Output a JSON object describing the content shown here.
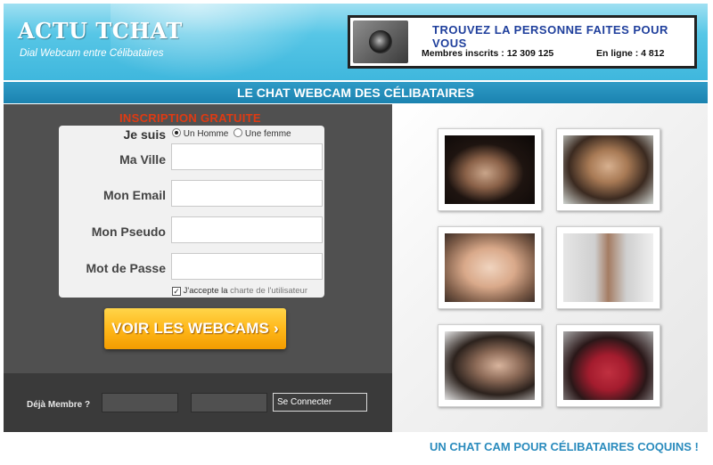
{
  "header": {
    "site_title": "ACTU TCHAT",
    "site_subtitle": "Dial Webcam entre Célibataires"
  },
  "banner": {
    "headline": "TROUVEZ LA PERSONNE FAITES POUR VOUS",
    "members_text": "Membres inscrits : 12 309 125",
    "online_text": "En ligne : 4 812",
    "icon": "webcam-icon"
  },
  "titlebar": {
    "text": "LE CHAT WEBCAM DES CÉLIBATAIRES"
  },
  "signup": {
    "heading": "INSCRIPTION GRATUITE",
    "je_suis_label": "Je suis",
    "gender_options": [
      "Un Homme",
      "Une femme"
    ],
    "gender_selected": "Un Homme",
    "ville_label": "Ma Ville",
    "email_label": "Mon Email",
    "pseudo_label": "Mon Pseudo",
    "password_label": "Mot de Passe",
    "ville_value": "",
    "email_value": "",
    "pseudo_value": "",
    "password_value": "",
    "accept_prefix": "J'accepte la",
    "accept_link": "charte de l'utilisateur",
    "accept_checked": true,
    "cta_label": "VOIR LES WEBCAMS ›"
  },
  "login": {
    "label": "Déjà Membre ?",
    "pseudo_value": "",
    "password_value": "",
    "connect_label": "Se Connecter"
  },
  "gallery": {
    "photos": [
      {
        "name": "profile-photo-1"
      },
      {
        "name": "profile-photo-2"
      },
      {
        "name": "profile-photo-3"
      },
      {
        "name": "profile-photo-4"
      },
      {
        "name": "profile-photo-5"
      },
      {
        "name": "profile-photo-6"
      }
    ]
  },
  "footer": {
    "slogan": "UN CHAT CAM POUR CÉLIBATAIRES COQUINS !"
  },
  "colors": {
    "header_blue": "#3fb7dd",
    "titlebar_blue": "#1b83b0",
    "heading_red": "#e03a12",
    "cta_orange": "#ffb81a",
    "slogan_blue": "#2a8bbd"
  }
}
